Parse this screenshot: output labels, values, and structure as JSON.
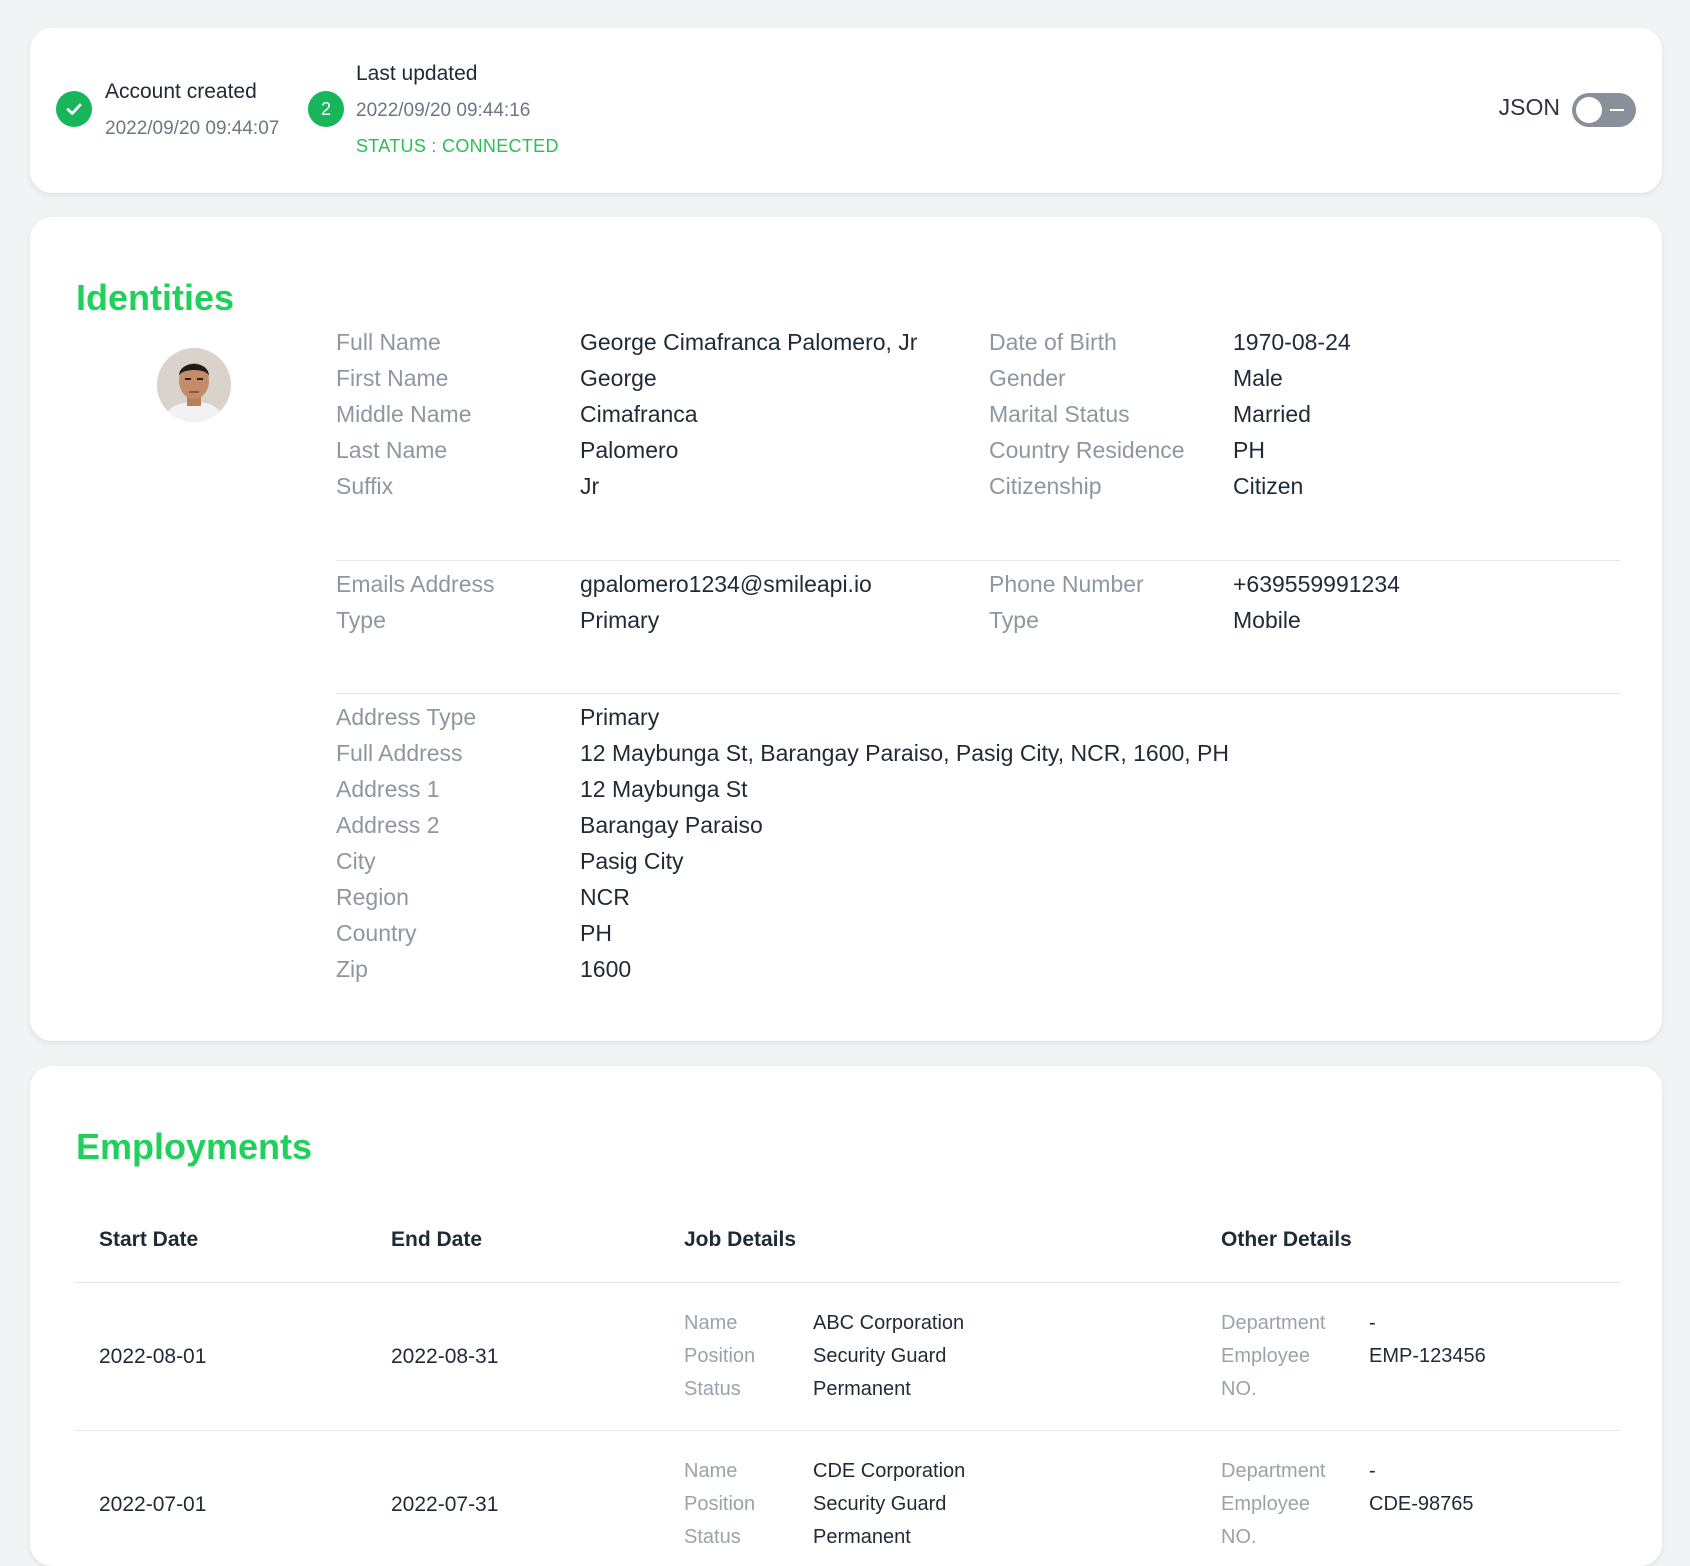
{
  "status": {
    "created_label": "Account created",
    "created_time": "2022/09/20 09:44:07",
    "updated_step": "2",
    "updated_label": "Last updated",
    "updated_time": "2022/09/20 09:44:16",
    "status_text": "STATUS : CONNECTED",
    "json_label": "JSON",
    "json_toggle_on": false
  },
  "identities": {
    "title": "Identities",
    "personal_left": [
      {
        "key": "Full Name",
        "value": "George Cimafranca Palomero, Jr"
      },
      {
        "key": "First Name",
        "value": "George"
      },
      {
        "key": "Middle Name",
        "value": "Cimafranca"
      },
      {
        "key": "Last Name",
        "value": "Palomero"
      },
      {
        "key": "Suffix",
        "value": "Jr"
      }
    ],
    "personal_right": [
      {
        "key": "Date of Birth",
        "value": "1970-08-24"
      },
      {
        "key": "Gender",
        "value": "Male"
      },
      {
        "key": "Marital Status",
        "value": "Married"
      },
      {
        "key": "Country Residence",
        "value": "PH"
      },
      {
        "key": "Citizenship",
        "value": "Citizen"
      }
    ],
    "contact_left": [
      {
        "key": "Emails Address",
        "value": "gpalomero1234@smileapi.io"
      },
      {
        "key": "Type",
        "value": "Primary"
      }
    ],
    "contact_right": [
      {
        "key": "Phone Number",
        "value": "+639559991234"
      },
      {
        "key": "Type",
        "value": "Mobile"
      }
    ],
    "address": [
      {
        "key": "Address Type",
        "value": "Primary"
      },
      {
        "key": "Full Address",
        "value": "12 Maybunga St, Barangay Paraiso, Pasig City, NCR, 1600, PH"
      },
      {
        "key": "Address 1",
        "value": "12 Maybunga St"
      },
      {
        "key": "Address 2",
        "value": "Barangay Paraiso"
      },
      {
        "key": "City",
        "value": "Pasig City"
      },
      {
        "key": "Region",
        "value": "NCR"
      },
      {
        "key": "Country",
        "value": "PH"
      },
      {
        "key": "Zip",
        "value": "1600"
      }
    ]
  },
  "employments": {
    "title": "Employments",
    "headers": [
      "Start Date",
      "End Date",
      "Job Details",
      "Other Details"
    ],
    "rows": [
      {
        "start": "2022-08-01",
        "end": "2022-08-31",
        "job": [
          {
            "key": "Name",
            "value": "ABC Corporation"
          },
          {
            "key": "Position",
            "value": "Security Guard"
          },
          {
            "key": "Status",
            "value": "Permanent"
          }
        ],
        "other": [
          {
            "key": "Department",
            "value": "-"
          },
          {
            "key": "Employee",
            "value": "EMP-123456"
          },
          {
            "key": "NO.",
            "value": ""
          }
        ]
      },
      {
        "start": "2022-07-01",
        "end": "2022-07-31",
        "job": [
          {
            "key": "Name",
            "value": "CDE Corporation"
          },
          {
            "key": "Position",
            "value": "Security Guard"
          },
          {
            "key": "Status",
            "value": "Permanent"
          }
        ],
        "other": [
          {
            "key": "Department",
            "value": "-"
          },
          {
            "key": "Employee",
            "value": "CDE-98765"
          },
          {
            "key": "NO.",
            "value": ""
          }
        ]
      }
    ]
  }
}
